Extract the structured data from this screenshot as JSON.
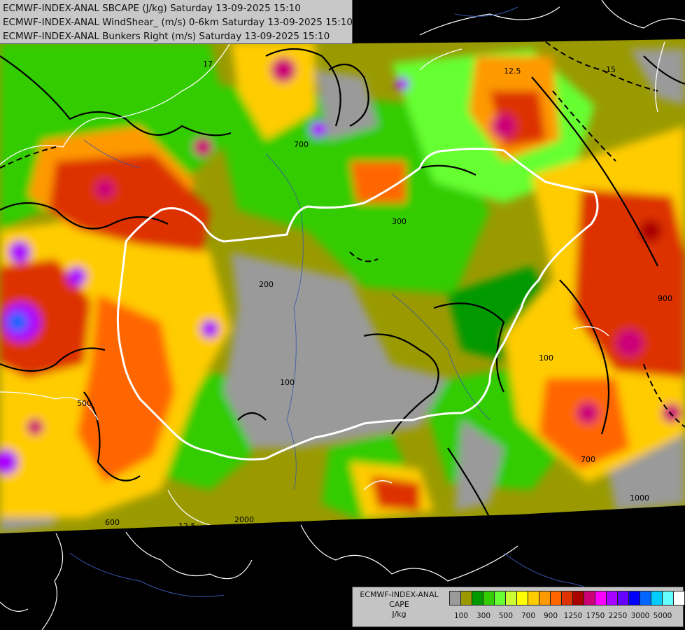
{
  "titles": [
    "ECMWF-INDEX-ANAL SBCAPE (J/kg) Saturday 13-09-2025 15:10",
    "ECMWF-INDEX-ANAL WindShear_ (m/s) 0-6km Saturday 13-09-2025 15:10",
    "ECMWF-INDEX-ANAL Bunkers Right (m/s) Saturday 13-09-2025 15:10"
  ],
  "legend": {
    "line1": "ECMWF-INDEX-ANAL",
    "line2": "CAPE",
    "line3": "J/kg",
    "colors": [
      "#9a9a9a",
      "#9a9a00",
      "#009900",
      "#33cc00",
      "#66ff33",
      "#ccff33",
      "#ffff00",
      "#ffcc00",
      "#ff9900",
      "#ff6600",
      "#dd3300",
      "#aa0000",
      "#cc0077",
      "#ff00ff",
      "#aa00ff",
      "#6600ff",
      "#0000ff",
      "#0066ff",
      "#00ccff",
      "#66ffff",
      "#ffffff"
    ],
    "tick_labels": [
      "100",
      "300",
      "500",
      "700",
      "900",
      "1250",
      "1750",
      "2250",
      "3000",
      "5000"
    ]
  },
  "contour_labels": [
    "100",
    "200",
    "300",
    "500",
    "600",
    "700",
    "900",
    "1000",
    "2000",
    "12.5",
    "15",
    "17"
  ],
  "colors": {
    "background": "#000000",
    "nodata": "#9a9a9a",
    "border": "#ffffff",
    "contour": "#000000"
  }
}
